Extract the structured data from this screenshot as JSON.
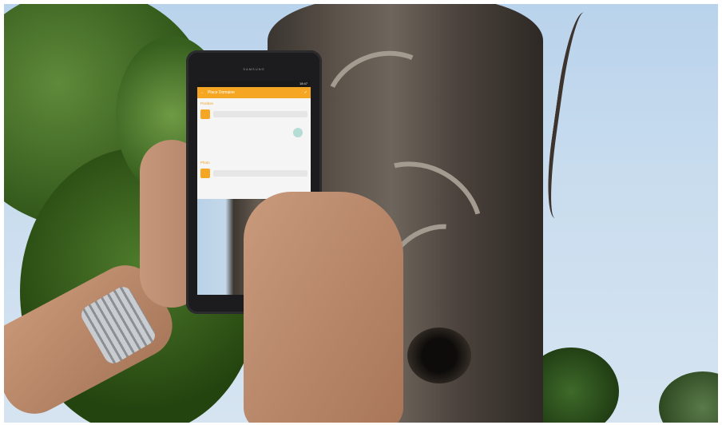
{
  "scene": {
    "tablet": {
      "brand": "SAMSUNG",
      "status_time": "18:47",
      "app_title": "Place Domaine",
      "sections": [
        {
          "title": "Position"
        },
        {
          "title": "Photo"
        }
      ],
      "accent_color": "#f5a623"
    }
  }
}
